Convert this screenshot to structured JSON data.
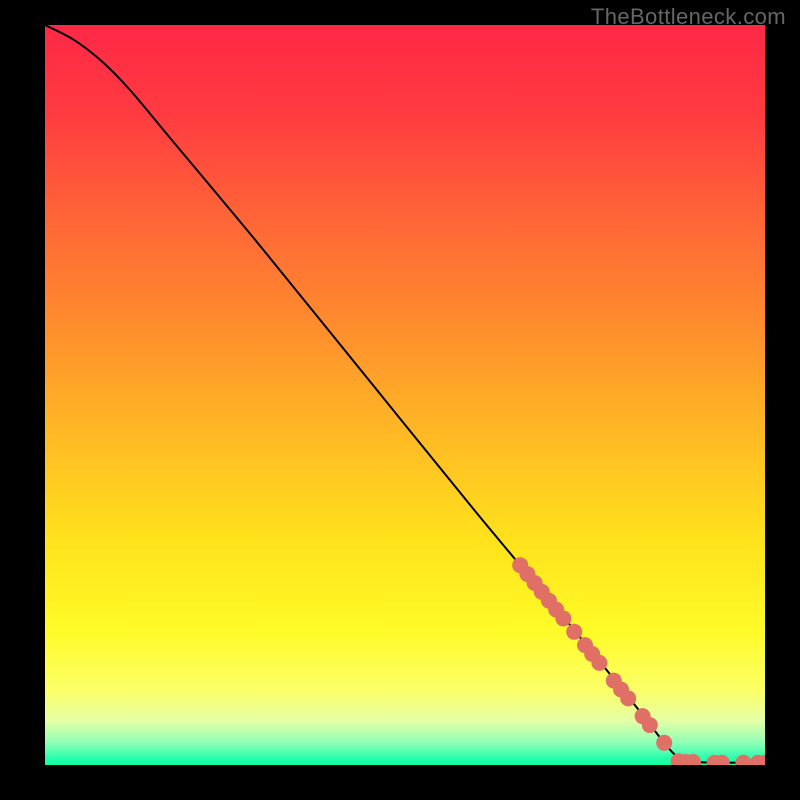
{
  "attribution": "TheBottleneck.com",
  "chart_data": {
    "type": "line",
    "title": "",
    "xlabel": "",
    "ylabel": "",
    "xlim": [
      0,
      100
    ],
    "ylim": [
      0,
      100
    ],
    "curve": [
      {
        "x": 0,
        "y": 100
      },
      {
        "x": 4,
        "y": 98
      },
      {
        "x": 8,
        "y": 95
      },
      {
        "x": 12,
        "y": 91
      },
      {
        "x": 18,
        "y": 84
      },
      {
        "x": 30,
        "y": 70
      },
      {
        "x": 45,
        "y": 52
      },
      {
        "x": 60,
        "y": 34
      },
      {
        "x": 72,
        "y": 20
      },
      {
        "x": 82,
        "y": 8
      },
      {
        "x": 86,
        "y": 3
      },
      {
        "x": 88,
        "y": 1
      },
      {
        "x": 90,
        "y": 0.4
      },
      {
        "x": 100,
        "y": 0.3
      }
    ],
    "markers": [
      {
        "x": 66,
        "y": 27.0
      },
      {
        "x": 67,
        "y": 25.8
      },
      {
        "x": 68,
        "y": 24.6
      },
      {
        "x": 69,
        "y": 23.4
      },
      {
        "x": 70,
        "y": 22.2
      },
      {
        "x": 71,
        "y": 21.0
      },
      {
        "x": 72,
        "y": 19.8
      },
      {
        "x": 73.5,
        "y": 18.0
      },
      {
        "x": 75,
        "y": 16.2
      },
      {
        "x": 76,
        "y": 15.0
      },
      {
        "x": 77,
        "y": 13.8
      },
      {
        "x": 79,
        "y": 11.4
      },
      {
        "x": 80,
        "y": 10.2
      },
      {
        "x": 81,
        "y": 9.0
      },
      {
        "x": 83,
        "y": 6.6
      },
      {
        "x": 84,
        "y": 5.4
      },
      {
        "x": 86,
        "y": 3.0
      },
      {
        "x": 88,
        "y": 0.5
      },
      {
        "x": 89,
        "y": 0.4
      },
      {
        "x": 90,
        "y": 0.4
      },
      {
        "x": 93,
        "y": 0.3
      },
      {
        "x": 94,
        "y": 0.3
      },
      {
        "x": 97,
        "y": 0.3
      },
      {
        "x": 99,
        "y": 0.3
      },
      {
        "x": 100,
        "y": 0.3
      }
    ],
    "gradient_stops": [
      {
        "offset": 0.0,
        "color": "#ff2846"
      },
      {
        "offset": 0.12,
        "color": "#ff3b41"
      },
      {
        "offset": 0.25,
        "color": "#ff6238"
      },
      {
        "offset": 0.4,
        "color": "#ff8b2e"
      },
      {
        "offset": 0.55,
        "color": "#ffb825"
      },
      {
        "offset": 0.7,
        "color": "#ffe31c"
      },
      {
        "offset": 0.82,
        "color": "#fffb28"
      },
      {
        "offset": 0.9,
        "color": "#fbff68"
      },
      {
        "offset": 0.94,
        "color": "#e5ffa6"
      },
      {
        "offset": 0.97,
        "color": "#8fffb8"
      },
      {
        "offset": 0.99,
        "color": "#2cffad"
      },
      {
        "offset": 1.0,
        "color": "#0bff9f"
      }
    ],
    "marker_color": "#e07066",
    "line_color": "#000000"
  }
}
